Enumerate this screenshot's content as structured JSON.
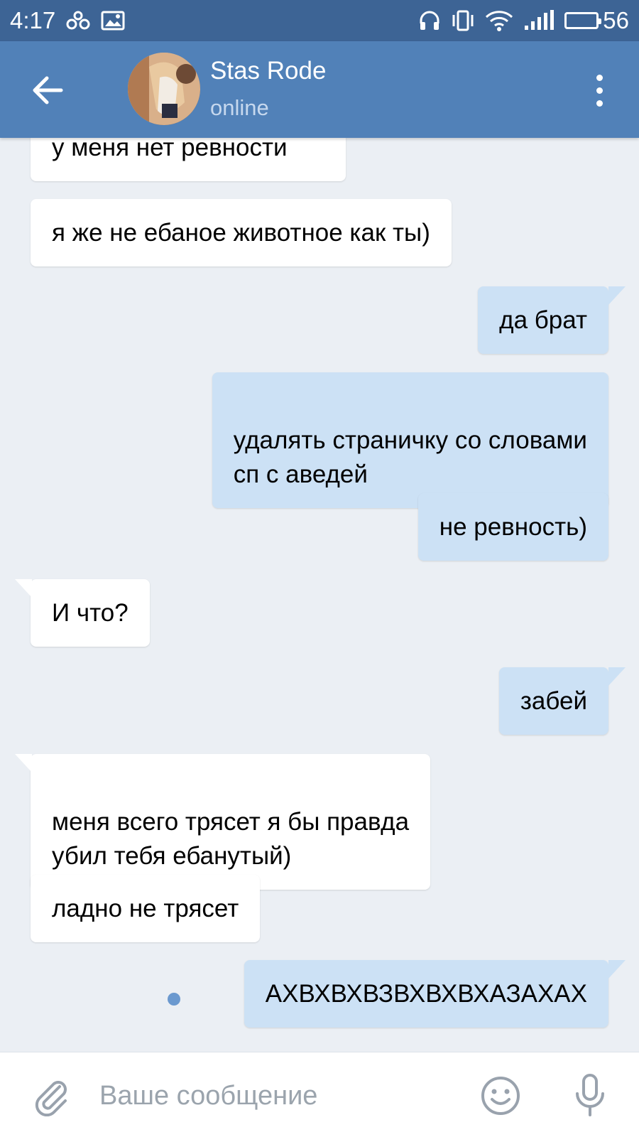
{
  "status_bar": {
    "time": "4:17",
    "battery": "56",
    "battery_level": 0.56,
    "icons": [
      "link-icon",
      "image-icon",
      "headphones-icon",
      "vibrate-icon",
      "wifi-icon",
      "signal-icon",
      "battery-icon"
    ]
  },
  "header": {
    "contact_name": "Stas Rode",
    "contact_status": "online",
    "icons": [
      "back-arrow-icon",
      "avatar",
      "more-vertical-icon"
    ]
  },
  "messages": [
    {
      "direction": "in",
      "text": "у меня нет ревности"
    },
    {
      "direction": "in",
      "text": "я же не ебаное животное как ты)"
    },
    {
      "direction": "out",
      "text": "да брат"
    },
    {
      "direction": "out",
      "text": "удалять страничку со словами\nсп с аведей"
    },
    {
      "direction": "out",
      "text": "не ревность)"
    },
    {
      "direction": "in",
      "text": "И что?"
    },
    {
      "direction": "out",
      "text": "забей"
    },
    {
      "direction": "in",
      "text": "меня всего трясет я бы правда\nубил тебя ебанутый)"
    },
    {
      "direction": "in",
      "text": "ладно не трясет"
    },
    {
      "direction": "out",
      "text": "АХВХВХВЗВХВХВХАЗАХАХ",
      "unread": true
    }
  ],
  "input_bar": {
    "placeholder": "Ваше сообщение",
    "icons": [
      "paperclip-icon",
      "smile-icon",
      "microphone-icon"
    ]
  },
  "colors": {
    "header": "#5181b8",
    "status_bar": "#3d6495",
    "background": "#ebeff4",
    "incoming_bubble": "#ffffff",
    "outgoing_bubble": "#cce1f5",
    "unread_dot": "#6b99cf"
  }
}
